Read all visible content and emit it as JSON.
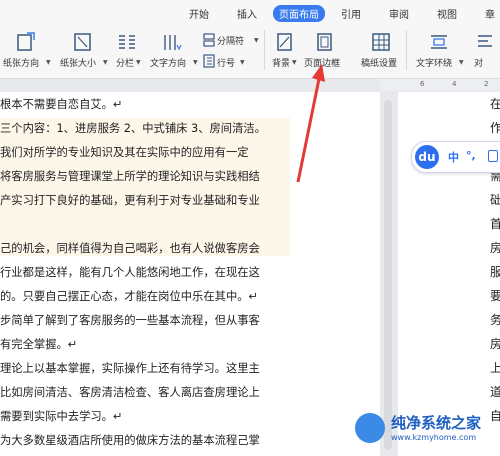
{
  "tabs": [
    "开始",
    "插入",
    "页面布局",
    "引用",
    "审阅",
    "视图",
    "章"
  ],
  "active_tab": "页面布局",
  "ribbon": {
    "paper_direction": "纸张方向",
    "paper_size": "纸张大小",
    "columns": "分栏",
    "text_direction": "文字方向",
    "page_break": "分隔符",
    "line_number": "行号",
    "background": "背景",
    "page_border": "页面边框",
    "manuscript": "稿纸设置",
    "text_wrap": "文字环绕",
    "align": "对"
  },
  "ruler": {
    "tick_6": "6",
    "tick_4": "4",
    "tick_2": "2"
  },
  "document_lines": [
    "根本不需要自恋自艾。↵",
    "三个内容：1、进房服务 2、中式铺床 3、房间清洁。",
    "我们对所学的专业知识及其在实际中的应用有一定",
    "将客房服务与管理课堂上所学的理论知识与实践相结",
    "产实习打下良好的基础，更有利于对专业基础和专业",
    "",
    "己的机会，同样值得为自己喝彩，也有人说做客房会",
    "行业都是这样，能有几个人能悠闲地工作，在现在这",
    "的。只要自己摆正心态，才能在岗位中乐在其中。↵",
    "步简单了解到了客房服务的一些基本流程，但从事客",
    "有完全掌握。↵",
    "理论上以基本掌握，实际操作上还有待学习。这里主",
    "比如房间清洁、客房清洁检查、客人离店查房理论上",
    "需要到实际中去学习。↵",
    "为大多数星级酒店所使用的做床方法的基本流程己掌"
  ],
  "right_page_chars": [
    "在",
    "作",
    "",
    "需",
    "础",
    "首",
    "房",
    "服",
    "要",
    "务",
    "房",
    "",
    "上",
    "道",
    "自"
  ],
  "ime": {
    "logo": "du",
    "text1": "中",
    "text2": "°,"
  },
  "watermark": {
    "title": "纯净系统之家",
    "url": "www.kzmyhome.com"
  },
  "colors": {
    "accent": "#3a7bf0",
    "arrow": "#e53935"
  }
}
